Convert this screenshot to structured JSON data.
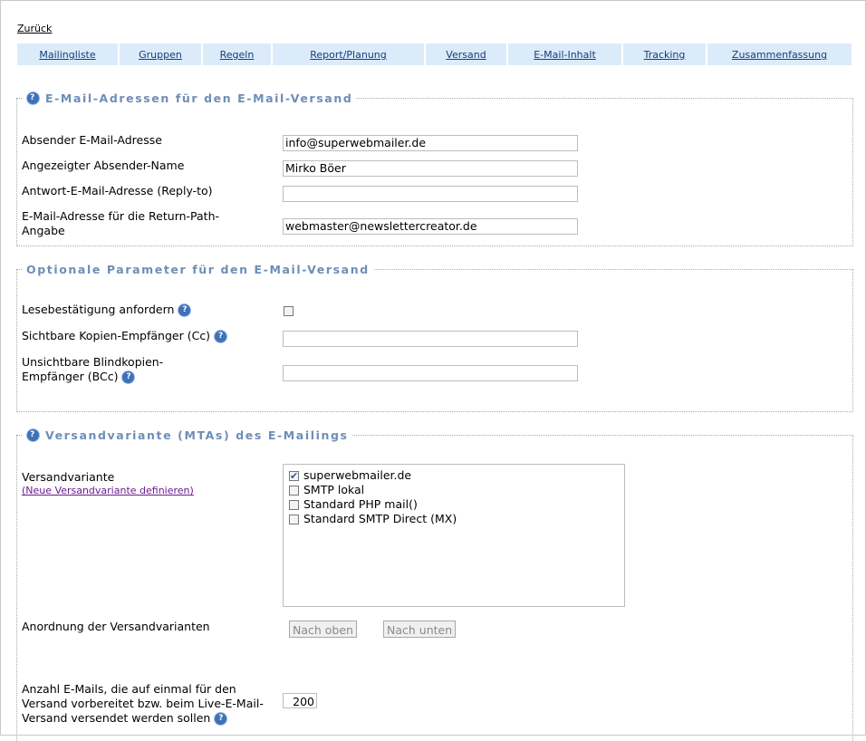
{
  "nav": {
    "back": "Zurück",
    "tabs": [
      "Mailingliste",
      "Gruppen",
      "Regeln",
      "Report/Planung",
      "Versand",
      "E-Mail-Inhalt",
      "Tracking",
      "Zusammenfassung"
    ]
  },
  "section1": {
    "title": "E-Mail-Adressen für den E-Mail-Versand",
    "sender_email_label": "Absender E-Mail-Adresse",
    "sender_email_value": "info@superwebmailer.de",
    "sender_name_label": "Angezeigter Absender-Name",
    "sender_name_value": "Mirko Böer",
    "reply_to_label": "Antwort-E-Mail-Adresse (Reply-to)",
    "reply_to_value": "",
    "return_path_label": "E-Mail-Adresse für die Return-Path-Angabe",
    "return_path_value": "webmaster@newslettercreator.de"
  },
  "section2": {
    "title": "Optionale Parameter für den E-Mail-Versand",
    "read_receipt_label": "Lesebestätigung anfordern",
    "read_receipt_checked": false,
    "cc_label": "Sichtbare Kopien-Empfänger (Cc)",
    "cc_value": "",
    "bcc_label": "Unsichtbare Blindkopien-Empfänger (BCc)",
    "bcc_value": ""
  },
  "section3": {
    "title": "Versandvariante (MTAs) des E-Mailings",
    "variant_label": "Versandvariante",
    "new_variant_link": "(Neue Versandvariante definieren)",
    "variants": [
      {
        "label": "superwebmailer.de",
        "checked": true
      },
      {
        "label": "SMTP lokal",
        "checked": false
      },
      {
        "label": "Standard PHP mail()",
        "checked": false
      },
      {
        "label": "Standard SMTP Direct (MX)",
        "checked": false
      }
    ],
    "order_label": "Anordnung der Versandvarianten",
    "btn_up": "Nach oben",
    "btn_down": "Nach unten",
    "count_label": "Anzahl E-Mails, die auf einmal für den Versand vorbereitet bzw. beim Live-E-Mail-Versand versendet werden sollen",
    "count_value": "200"
  },
  "help_icon": "?"
}
